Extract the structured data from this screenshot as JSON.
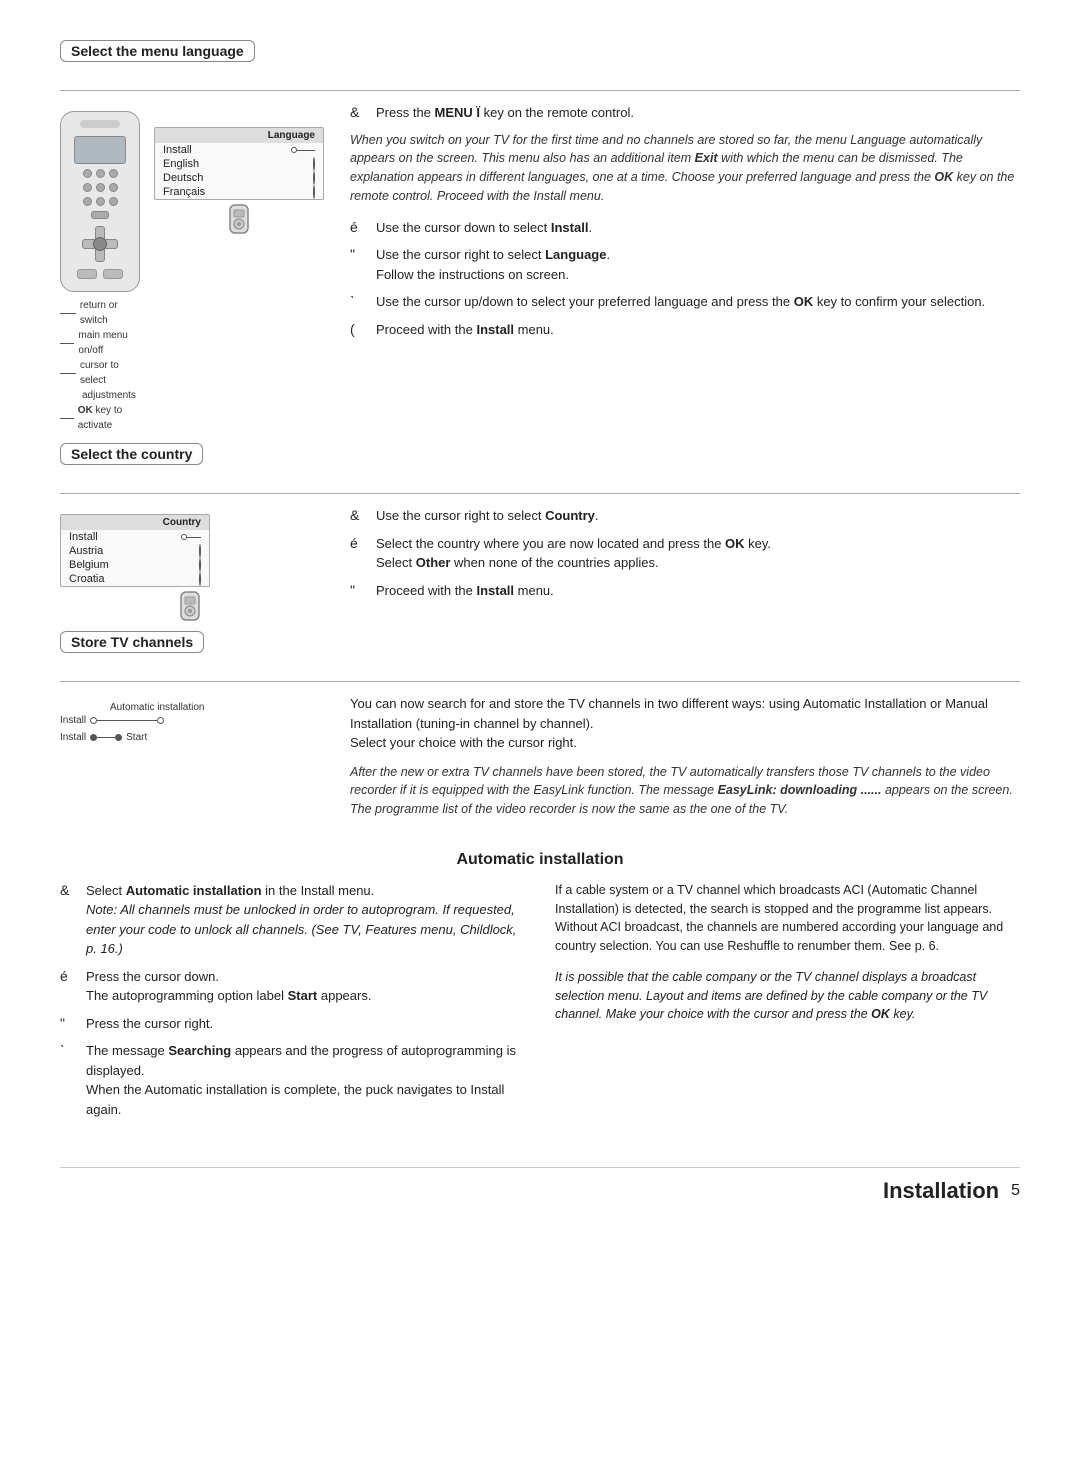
{
  "sections": {
    "menu_language": {
      "title": "Select the menu language",
      "intro_step": {
        "marker": "&",
        "text": "Press the ",
        "bold": "MENU",
        "symbol": "Ï",
        "text2": " key on the remote control."
      },
      "italic": "When you switch on your TV for the first time and no channels are stored so far, the menu Language automatically appears on the screen. This menu also has an additional item Exit with which the menu can be dismissed. The explanation appears in different languages, one at a time. Choose your preferred language and press the OK key on the remote control. Proceed with the Install menu.",
      "steps": [
        {
          "marker": "é",
          "text": "Use the cursor down to select ",
          "bold": "Install",
          "text2": "."
        },
        {
          "marker": "\"\"",
          "text": "Use the cursor right to select ",
          "bold": "Language",
          "text2": ".\nFollow the instructions on screen."
        },
        {
          "marker": "ˋ",
          "text": "Use the cursor up/down to select your preferred language and press the ",
          "bold_ok": "OK",
          "text2": " key to confirm your selection."
        },
        {
          "marker": "(",
          "text": "Proceed with the ",
          "bold": "Install",
          "text2": " menu."
        }
      ],
      "remote_annotations": [
        "return or switch",
        "main menu on/off",
        "cursor to select",
        "adjustments",
        "OK key to activate"
      ],
      "menu_items": [
        {
          "label": "Language",
          "header": true
        },
        {
          "label": "Install",
          "selected": false,
          "indent": false
        },
        {
          "label": "English",
          "selected": false
        },
        {
          "label": "Deutsch",
          "selected": false
        },
        {
          "label": "Français",
          "selected": false
        }
      ]
    },
    "country": {
      "title": "Select the country",
      "steps": [
        {
          "marker": "&",
          "text": "Use the cursor right to select ",
          "bold": "Country",
          "text2": "."
        },
        {
          "marker": "é",
          "text": "Select the country where you are now located and press the ",
          "bold_ok": "OK",
          "text2": " key.\nSelect ",
          "bold2": "Other",
          "text3": " when none of the countries applies."
        },
        {
          "marker": "\"\"",
          "text": "Proceed with the ",
          "bold": "Install",
          "text2": " menu."
        }
      ],
      "menu_items": [
        {
          "label": "Country",
          "header": true
        },
        {
          "label": "Install",
          "line": true
        },
        {
          "label": "Austria"
        },
        {
          "label": "Belgium"
        },
        {
          "label": "Croatia"
        }
      ]
    },
    "store_tv": {
      "title": "Store TV channels",
      "description": "You can now search for and store the TV channels in two different ways: using Automatic Installation or Manual Installation (tuning-in channel by channel).\nSelect your choice with the cursor right.",
      "italic": "After the new or extra TV channels have been stored, the TV automatically transfers those TV channels to the video recorder if it is equipped with the EasyLink function. The message EasyLink: downloading ...... appears on the screen. The programme list of the video recorder is now the same as the one of the TV.",
      "italic_bold": "EasyLink: downloading ......",
      "diagram": {
        "row1_label": "Automatic installation",
        "row1_left": "Install",
        "row2_left": "Install",
        "row2_right": "Start"
      }
    },
    "auto_install": {
      "title": "Automatic installation",
      "left_steps": [
        {
          "marker": "&",
          "text": "Select ",
          "bold": "Automatic installation",
          "text2": " in the Install menu.",
          "italic": "Note: All channels must be unlocked in order to autoprogram. If requested, enter your code to unlock all channels. (See TV, Features menu, Childlock, p. 16.)"
        },
        {
          "marker": "é",
          "text": "Press the cursor down.\nThe autoprogramming option label ",
          "bold": "Start",
          "text2": " appears."
        },
        {
          "marker": "\"\"",
          "text": "Press the cursor right."
        },
        {
          "marker": "ˋ",
          "text": "The message ",
          "bold": "Searching",
          "text2": " appears and the progress of autoprogramming is displayed.\nWhen the Automatic installation is complete, the puck navigates to Install again."
        }
      ],
      "right_col": {
        "para1": "If a cable system or a TV channel which broadcasts ACI (Automatic Channel Installation) is detected, the search is stopped and the programme list appears.\nWithout ACI broadcast, the channels are numbered according your language and country selection. You can use Reshuffle to renumber them. See p. 6.",
        "para2": "It is possible that the cable company or the TV channel displays a broadcast selection menu. Layout and items are defined by the cable company or the TV channel. Make your choice with the cursor and press the ",
        "para2_bold": "OK",
        "para2_end": " key."
      }
    }
  },
  "footer": {
    "title": "Installation",
    "page": "5"
  }
}
